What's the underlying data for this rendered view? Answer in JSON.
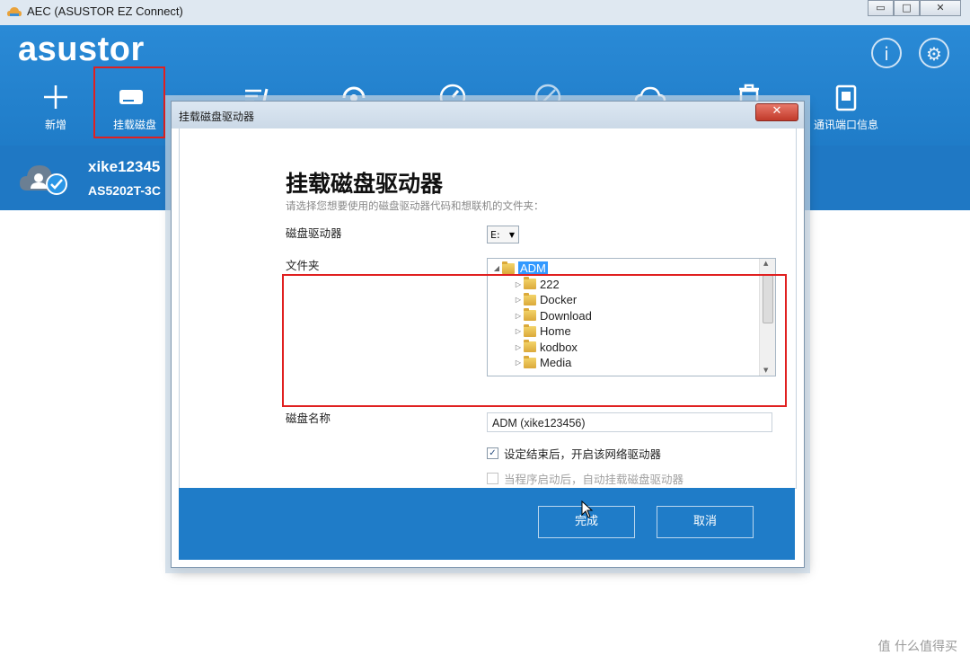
{
  "window": {
    "title": "AEC (ASUSTOR EZ Connect)",
    "minimize": "▭",
    "maximize": "□",
    "close": "✕"
  },
  "header": {
    "logo": "asustor",
    "info_glyph": "i",
    "settings_glyph": "⚙",
    "toolbar": {
      "add_label": "新增",
      "mount_label": "挂载磁盘",
      "ports_label": "通讯端口信息"
    }
  },
  "connection": {
    "name": "xike12345",
    "model": "AS5202T-3C"
  },
  "dialog": {
    "title": "挂载磁盘驱动器",
    "close_glyph": "✕",
    "heading": "挂载磁盘驱动器",
    "subtitle": "请选择您想要使用的磁盘驱动器代码和想联机的文件夹：",
    "drive_label": "磁盘驱动器",
    "drive_value": "E:",
    "folder_label": "文件夹",
    "tree": {
      "root": "ADM",
      "children": [
        "222",
        "Docker",
        "Download",
        "Home",
        "kodbox",
        "Media"
      ]
    },
    "name_label": "磁盘名称",
    "name_value": "ADM (xike123456)",
    "option_open_after": "设定结束后，开启该网络驱动器",
    "option_auto_mount": "当程序启动后，自动挂载磁盘驱动器",
    "finish_button": "完成",
    "cancel_button": "取消"
  },
  "watermark": "值 什么值得买"
}
